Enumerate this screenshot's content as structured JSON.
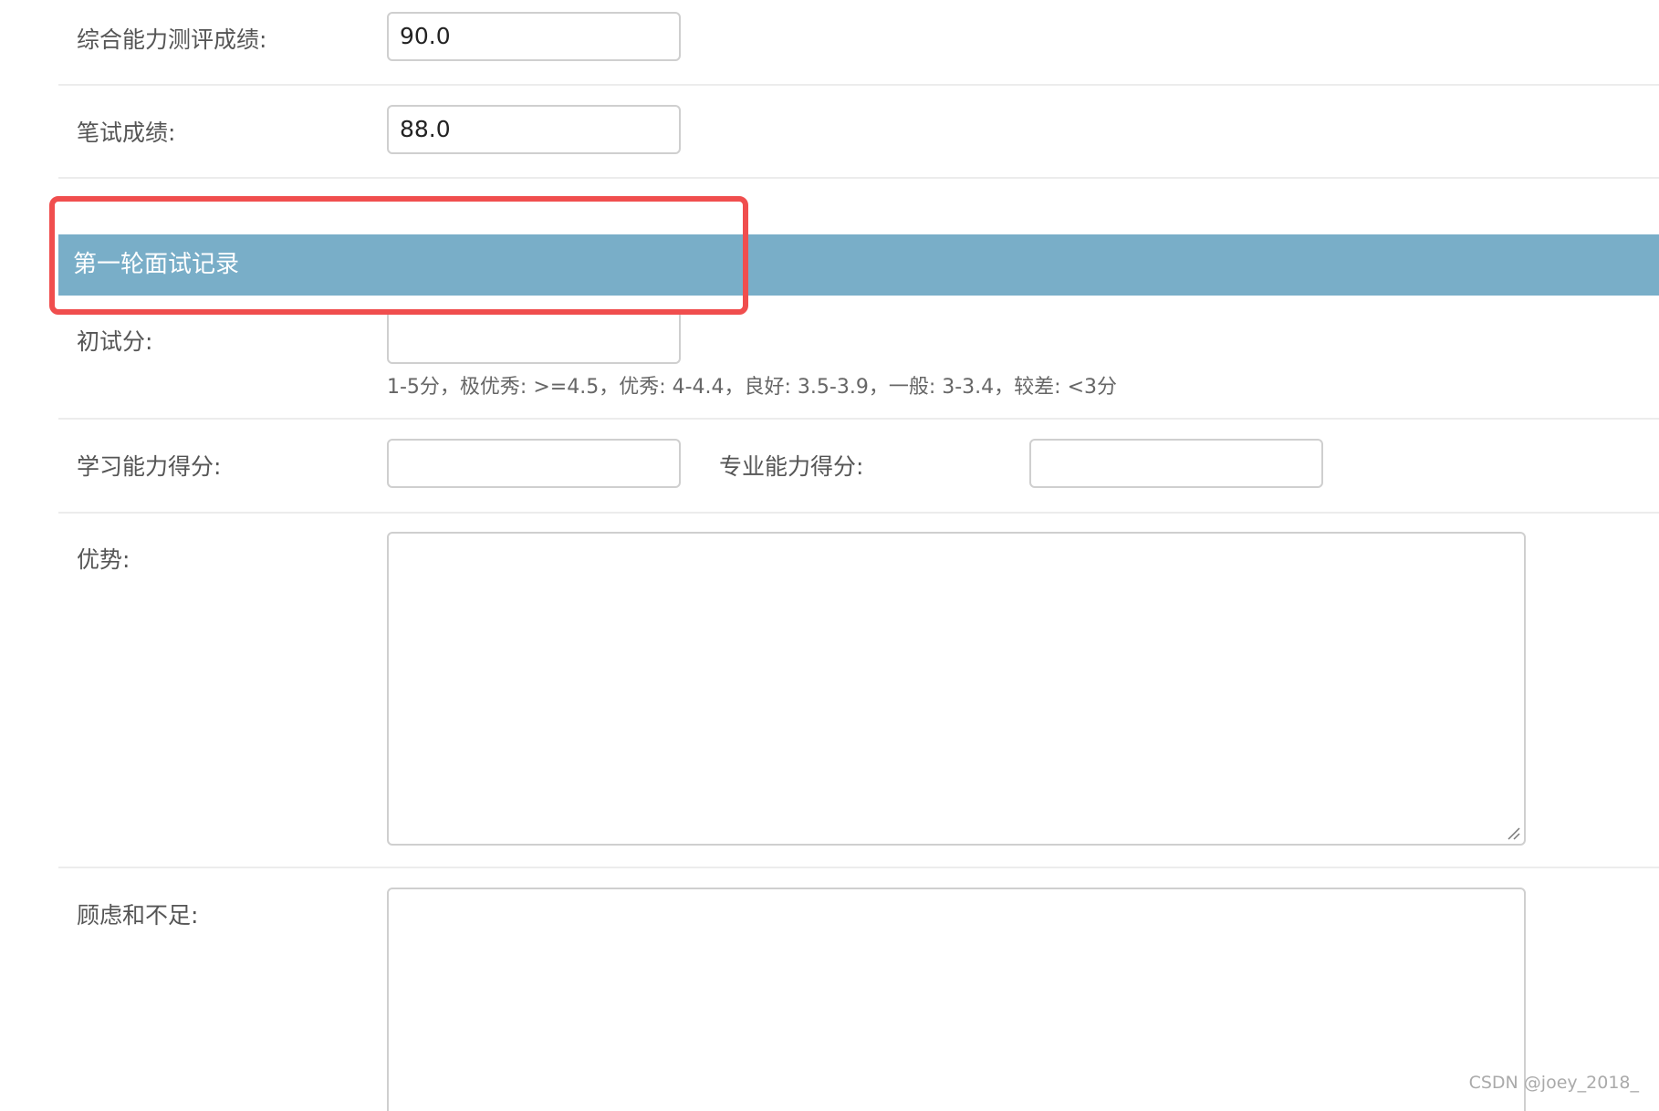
{
  "fields": {
    "comprehensive": {
      "label": "综合能力测评成绩:",
      "value": "90.0"
    },
    "written": {
      "label": "笔试成绩:",
      "value": "88.0"
    }
  },
  "section": {
    "title": "第一轮面试记录"
  },
  "first_interview": {
    "label": "初试分:",
    "value": "",
    "help": "1-5分，极优秀: >=4.5，优秀: 4-4.4，良好: 3.5-3.9，一般: 3-3.4，较差: <3分"
  },
  "learning_score": {
    "label": "学习能力得分:",
    "value": ""
  },
  "professional_score": {
    "label": "专业能力得分:",
    "value": ""
  },
  "advantages": {
    "label": "优势:"
  },
  "concerns": {
    "label": "顾虑和不足:"
  },
  "watermark": "CSDN @joey_2018_",
  "colors": {
    "section_header_bg": "#79aec8",
    "highlight_border": "#f04e4e"
  }
}
